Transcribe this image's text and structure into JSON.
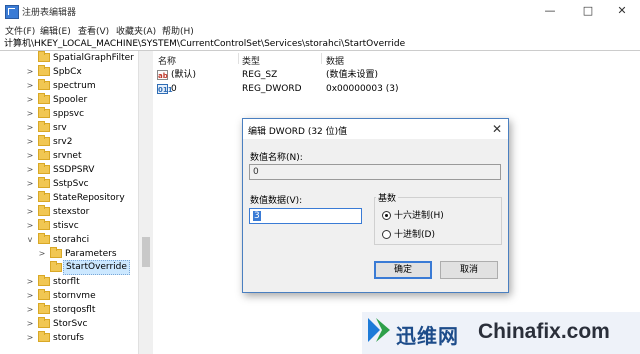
{
  "window": {
    "title": "注册表编辑器",
    "minimize_glyph": "—",
    "maximize_glyph": "□",
    "close_glyph": "✕"
  },
  "menu": [
    "文件(F)",
    "编辑(E)",
    "查看(V)",
    "收藏夹(A)",
    "帮助(H)"
  ],
  "address": "计算机\\HKEY_LOCAL_MACHINE\\SYSTEM\\CurrentControlSet\\Services\\storahci\\StartOverride",
  "tree": {
    "items": [
      {
        "label": "SpatialGraphFilter",
        "chevron": ""
      },
      {
        "label": "SpbCx",
        "chevron": ">"
      },
      {
        "label": "spectrum",
        "chevron": ">"
      },
      {
        "label": "Spooler",
        "chevron": ">"
      },
      {
        "label": "sppsvc",
        "chevron": ">"
      },
      {
        "label": "srv",
        "chevron": ">"
      },
      {
        "label": "srv2",
        "chevron": ">"
      },
      {
        "label": "srvnet",
        "chevron": ">"
      },
      {
        "label": "SSDPSRV",
        "chevron": ">"
      },
      {
        "label": "SstpSvc",
        "chevron": ">"
      },
      {
        "label": "StateRepository",
        "chevron": ">"
      },
      {
        "label": "stexstor",
        "chevron": ">"
      },
      {
        "label": "stisvc",
        "chevron": ">"
      },
      {
        "label": "storahci",
        "chevron": "v"
      },
      {
        "label": "Parameters",
        "chevron": ">"
      },
      {
        "label": "StartOverride",
        "chevron": ""
      },
      {
        "label": "storflt",
        "chevron": ">"
      },
      {
        "label": "stornvme",
        "chevron": ">"
      },
      {
        "label": "storqosflt",
        "chevron": ">"
      },
      {
        "label": "StorSvc",
        "chevron": ">"
      },
      {
        "label": "storufs",
        "chevron": ">"
      }
    ]
  },
  "list": {
    "headers": {
      "name": "名称",
      "type": "类型",
      "data": "数据"
    },
    "rows": [
      {
        "icon": "ab",
        "name": "(默认)",
        "type": "REG_SZ",
        "data": "(数值未设置)"
      },
      {
        "icon": "011",
        "name": "0",
        "type": "REG_DWORD",
        "data": "0x00000003 (3)"
      }
    ]
  },
  "dialog": {
    "title": "编辑 DWORD (32 位)值",
    "close_glyph": "✕",
    "name_label": "数值名称(N):",
    "name_value": "0",
    "data_label": "数值数据(V):",
    "data_value": "3",
    "base_label": "基数",
    "hex_label": "十六进制(H)",
    "dec_label": "十进制(D)",
    "base_selected": "hex",
    "ok": "确定",
    "cancel": "取消"
  },
  "watermark": {
    "cn": "迅维网",
    "en": "Chinafix.com"
  },
  "colors": {
    "folder": "#f1c753",
    "selection": "#cce8ff",
    "accent": "#3a7bd5",
    "dialog_bg": "#f0f0f0"
  }
}
